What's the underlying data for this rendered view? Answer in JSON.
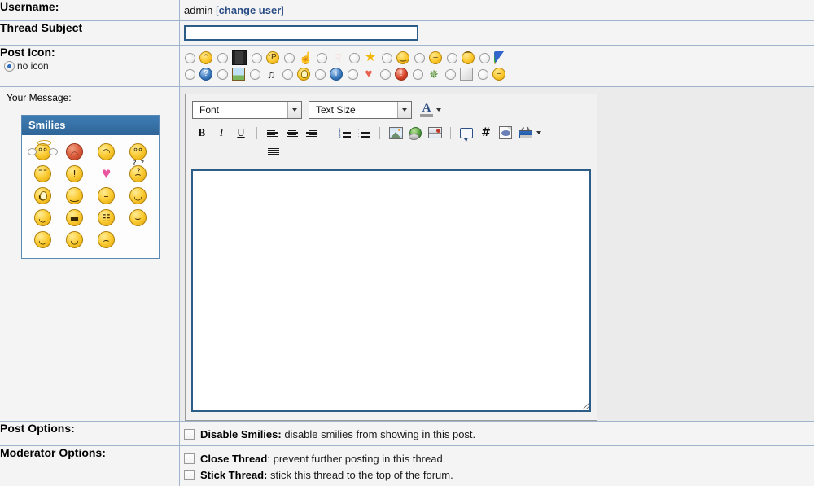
{
  "rows": {
    "username": {
      "label": "Username:",
      "value": "admin",
      "change_user_label": "change user",
      "bracket_open": "[",
      "bracket_close": "]",
      "link_color": "#2a4c85"
    },
    "thread_subject": {
      "label": "Thread Subject",
      "input_value": "",
      "input_placeholder": "",
      "border_color": "#2c5d87"
    },
    "post_icon": {
      "label": "Post Icon:",
      "no_icon_label": "no icon",
      "no_icon_selected": true,
      "icons_row1": [
        {
          "name": "icon-smile-teeth",
          "glyph": "ᵔ",
          "kind": "yellow"
        },
        {
          "name": "icon-film",
          "glyph": "▓",
          "kind": "film"
        },
        {
          "name": "icon-tongue",
          "glyph": ":P",
          "kind": "yellow"
        },
        {
          "name": "icon-thumbs-up",
          "glyph": "☝",
          "kind": "hand"
        },
        {
          "name": "icon-thumbs-down",
          "glyph": "☟",
          "kind": "hand"
        },
        {
          "name": "icon-star",
          "glyph": "★",
          "kind": "star"
        },
        {
          "name": "icon-happy",
          "glyph": "‿",
          "kind": "yellow"
        },
        {
          "name": "icon-neutral",
          "glyph": "–",
          "kind": "yellow"
        },
        {
          "name": "icon-sad",
          "glyph": "⁀",
          "kind": "yellow"
        },
        {
          "name": "icon-rainbow",
          "glyph": "◜",
          "kind": "rainbow"
        }
      ],
      "icons_row2": [
        {
          "name": "icon-question",
          "glyph": "?",
          "kind": "blue"
        },
        {
          "name": "icon-picture",
          "glyph": "▲",
          "kind": "picture"
        },
        {
          "name": "icon-music",
          "glyph": "♫",
          "kind": "note"
        },
        {
          "name": "icon-lightbulb",
          "glyph": "●",
          "kind": "bulb"
        },
        {
          "name": "icon-info",
          "glyph": "i",
          "kind": "blue"
        },
        {
          "name": "icon-heart",
          "glyph": "♥",
          "kind": "heart"
        },
        {
          "name": "icon-exclamation",
          "glyph": "!",
          "kind": "red"
        },
        {
          "name": "icon-bug",
          "glyph": "✵",
          "kind": "bug"
        },
        {
          "name": "icon-box",
          "glyph": "□",
          "kind": "box"
        },
        {
          "name": "icon-frown",
          "glyph": "–",
          "kind": "yellow"
        }
      ]
    },
    "your_message": {
      "label": "Your Message:",
      "smilies": {
        "title": "Smilies",
        "items": [
          {
            "name": "smiley-angel",
            "glyph": "°°",
            "kind": "angel"
          },
          {
            "name": "smiley-angry",
            "glyph": "⌓",
            "kind": "red"
          },
          {
            "name": "smiley-smile",
            "glyph": "◠",
            "kind": "yellow"
          },
          {
            "name": "smiley-rolleyes",
            "glyph": "°°",
            "kind": "yellow"
          },
          {
            "name": "smiley-sleepy",
            "glyph": "¯¯",
            "kind": "yellow"
          },
          {
            "name": "smiley-exclaim",
            "glyph": "!",
            "kind": "yellow"
          },
          {
            "name": "smiley-heart",
            "glyph": "♥",
            "kind": "heart"
          },
          {
            "name": "smiley-confused",
            "glyph": "⌢",
            "kind": "question"
          },
          {
            "name": "smiley-idea",
            "glyph": "●",
            "kind": "bulb"
          },
          {
            "name": "smiley-smirk",
            "glyph": "‿",
            "kind": "yellow"
          },
          {
            "name": "smiley-thinking",
            "glyph": "–",
            "kind": "yellow"
          },
          {
            "name": "smiley-biggrin",
            "glyph": "◡",
            "kind": "yellow"
          },
          {
            "name": "smiley-wink",
            "glyph": "◡",
            "kind": "yellow"
          },
          {
            "name": "smiley-cool",
            "glyph": "▬",
            "kind": "yellow"
          },
          {
            "name": "smiley-grin",
            "glyph": "☷",
            "kind": "yellow"
          },
          {
            "name": "smiley-tongue",
            "glyph": "⌣",
            "kind": "yellow"
          },
          {
            "name": "smiley-happy1",
            "glyph": "◡",
            "kind": "yellow"
          },
          {
            "name": "smiley-happy2",
            "glyph": "◡",
            "kind": "yellow"
          },
          {
            "name": "smiley-frown",
            "glyph": "⌢",
            "kind": "yellow"
          }
        ]
      },
      "editor": {
        "font_select": {
          "value": "Font",
          "options": [
            "Font"
          ]
        },
        "size_select": {
          "value": "Text Size",
          "options": [
            "Text Size"
          ]
        },
        "font_color": {
          "name": "font-color-button",
          "letter": "A"
        },
        "buttons_row": [
          {
            "name": "bold-button",
            "label": "B",
            "type": "b"
          },
          {
            "name": "italic-button",
            "label": "I",
            "type": "i"
          },
          {
            "name": "underline-button",
            "label": "U",
            "type": "u"
          },
          {
            "name": "align-left-button",
            "label": "",
            "type": "align-left"
          },
          {
            "name": "align-center-button",
            "label": "",
            "type": "align-center"
          },
          {
            "name": "align-right-button",
            "label": "",
            "type": "align-right"
          },
          {
            "name": "ordered-list-button",
            "label": "",
            "type": "ol"
          },
          {
            "name": "unordered-list-button",
            "label": "",
            "type": "ul"
          },
          {
            "name": "insert-image-button",
            "label": "",
            "type": "image"
          },
          {
            "name": "insert-link-button",
            "label": "",
            "type": "globe"
          },
          {
            "name": "insert-email-button",
            "label": "",
            "type": "mail"
          },
          {
            "name": "insert-quote-button",
            "label": "",
            "type": "quote"
          },
          {
            "name": "insert-code-button",
            "label": "#",
            "type": "hash"
          },
          {
            "name": "insert-php-button",
            "label": "",
            "type": "php"
          },
          {
            "name": "insert-video-button",
            "label": "",
            "type": "tv"
          }
        ],
        "buttons_row2": [
          {
            "name": "align-justify-button",
            "label": "",
            "type": "align-just"
          }
        ],
        "textarea_value": "",
        "textarea_placeholder": ""
      }
    },
    "post_options": {
      "label": "Post Options:",
      "options": [
        {
          "name": "disable-smilies-checkbox",
          "checked": false,
          "title": "Disable Smilies:",
          "desc": " disable smilies from showing in this post."
        }
      ]
    },
    "moderator_options": {
      "label": "Moderator Options:",
      "options": [
        {
          "name": "close-thread-checkbox",
          "checked": false,
          "title": "Close Thread",
          "desc": ": prevent further posting in this thread."
        },
        {
          "name": "stick-thread-checkbox",
          "checked": false,
          "title": "Stick Thread:",
          "desc": " stick this thread to the top of the forum."
        }
      ]
    }
  },
  "colors": {
    "row_border": "#9fb3cc",
    "label_bg": "#f4f4f4",
    "editor_bg": "#ebebeb",
    "accent_blue": "#2c5d87",
    "smilies_header": "#2f6699"
  }
}
